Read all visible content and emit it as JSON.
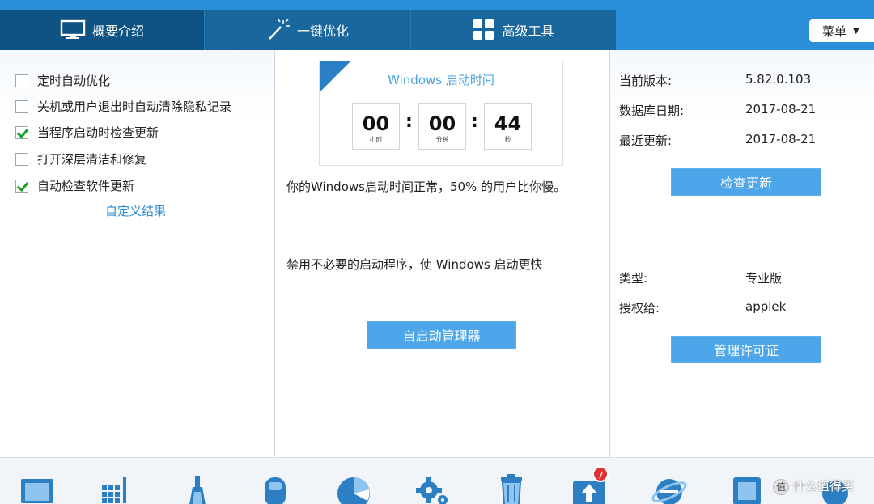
{
  "header": {
    "tabs": [
      {
        "label": "概要介绍",
        "icon": "monitor-icon",
        "active": true
      },
      {
        "label": "一键优化",
        "icon": "magic-wand-icon",
        "active": false
      },
      {
        "label": "高级工具",
        "icon": "grid-tiles-icon",
        "active": false
      }
    ],
    "menu_label": "菜单"
  },
  "left": {
    "options": [
      {
        "label": "定时自动优化",
        "checked": false
      },
      {
        "label": "关机或用户退出时自动清除隐私记录",
        "checked": false
      },
      {
        "label": "当程序启动时检查更新",
        "checked": true
      },
      {
        "label": "打开深层清洁和修复",
        "checked": false
      },
      {
        "label": "自动检查软件更新",
        "checked": true
      }
    ],
    "custom_link": "自定义结果"
  },
  "middle": {
    "timer_title": "Windows 启动时间",
    "timer": [
      {
        "value": "00",
        "unit": "小时"
      },
      {
        "value": "00",
        "unit": "分钟"
      },
      {
        "value": "44",
        "unit": "秒"
      }
    ],
    "status_text": "你的Windows启动时间正常，50% 的用户比你慢。",
    "tip_text": "禁用不必要的启动程序，使 Windows 启动更快",
    "startup_manager_button": "自启动管理器"
  },
  "right": {
    "current_version_label": "当前版本:",
    "current_version_value": "5.82.0.103",
    "db_date_label": "数据库日期:",
    "db_date_value": "2017-08-21",
    "last_update_label": "最近更新:",
    "last_update_value": "2017-08-21",
    "check_update_button": "检查更新",
    "type_label": "类型:",
    "type_value": "专业版",
    "licensed_to_label": "授权给:",
    "licensed_to_value": "applek",
    "manage_license_button": "管理许可证"
  },
  "toolbar": {
    "icons": [
      "screen-icon",
      "keypad-icon",
      "brush-icon",
      "mouse-icon",
      "pie-chart-icon",
      "gear-icon",
      "trash-recycle-icon",
      "upload-arrow-icon",
      "ie-browser-icon",
      "tool-card-icon",
      "blue-circle-icon"
    ],
    "update_badge": "7"
  },
  "watermark": {
    "text": "什么值得买"
  },
  "colors": {
    "header": "#2a8fd8",
    "active_tab": "#0f5284",
    "button": "#4ea6ea",
    "link": "#2f8fd6",
    "badge": "#e03232"
  }
}
